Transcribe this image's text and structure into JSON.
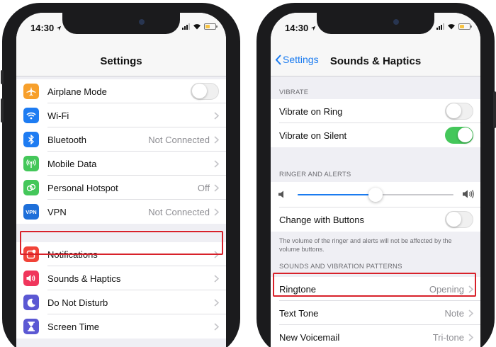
{
  "left_phone": {
    "status": {
      "time": "14:30"
    },
    "nav_title": "Settings",
    "group1": [
      {
        "label": "Airplane Mode",
        "icon": "airplane-icon",
        "color": "#f7a02c",
        "control": "toggle",
        "on": false
      },
      {
        "label": "Wi-Fi",
        "icon": "wifi-icon",
        "color": "#1e7cf2",
        "value": "",
        "control": "chevron"
      },
      {
        "label": "Bluetooth",
        "icon": "bluetooth-icon",
        "color": "#1e7cf2",
        "value": "Not Connected",
        "control": "chevron"
      },
      {
        "label": "Mobile Data",
        "icon": "antenna-icon",
        "color": "#44c75a",
        "value": "",
        "control": "chevron"
      },
      {
        "label": "Personal Hotspot",
        "icon": "hotspot-icon",
        "color": "#44c75a",
        "value": "Off",
        "control": "chevron"
      },
      {
        "label": "VPN",
        "icon": "vpn-icon",
        "icon_text": "VPN",
        "color": "#1e6fd9",
        "value": "Not Connected",
        "control": "chevron"
      }
    ],
    "group2": [
      {
        "label": "Notifications",
        "icon": "notifications-icon",
        "color": "#f14338",
        "value": "",
        "control": "chevron",
        "highlighted": true
      },
      {
        "label": "Sounds & Haptics",
        "icon": "speaker-icon",
        "color": "#f0365c",
        "value": "",
        "control": "chevron"
      },
      {
        "label": "Do Not Disturb",
        "icon": "moon-icon",
        "color": "#5b58d3",
        "value": "",
        "control": "chevron"
      },
      {
        "label": "Screen Time",
        "icon": "hourglass-icon",
        "color": "#5b58d3",
        "value": "",
        "control": "chevron"
      }
    ]
  },
  "right_phone": {
    "status": {
      "time": "14:30"
    },
    "back_label": "Settings",
    "nav_title": "Sounds & Haptics",
    "vibrate_header": "VIBRATE",
    "vibrate_rows": [
      {
        "label": "Vibrate on Ring",
        "on": false
      },
      {
        "label": "Vibrate on Silent",
        "on": true
      }
    ],
    "ringer_header": "RINGER AND ALERTS",
    "ringer_volume": 0.5,
    "change_with_buttons": {
      "label": "Change with Buttons",
      "on": false
    },
    "ringer_footer": "The volume of the ringer and alerts will not be affected by the volume buttons.",
    "patterns_header": "SOUNDS AND VIBRATION PATTERNS",
    "patterns": [
      {
        "label": "Ringtone",
        "value": "Opening",
        "highlighted": true
      },
      {
        "label": "Text Tone",
        "value": "Note"
      },
      {
        "label": "New Voicemail",
        "value": "Tri-tone"
      }
    ]
  },
  "colors": {
    "accent": "#1a7bf0",
    "toggle_on": "#44c75a",
    "highlight": "#d8212a",
    "grouped_bg": "#efeff4"
  }
}
